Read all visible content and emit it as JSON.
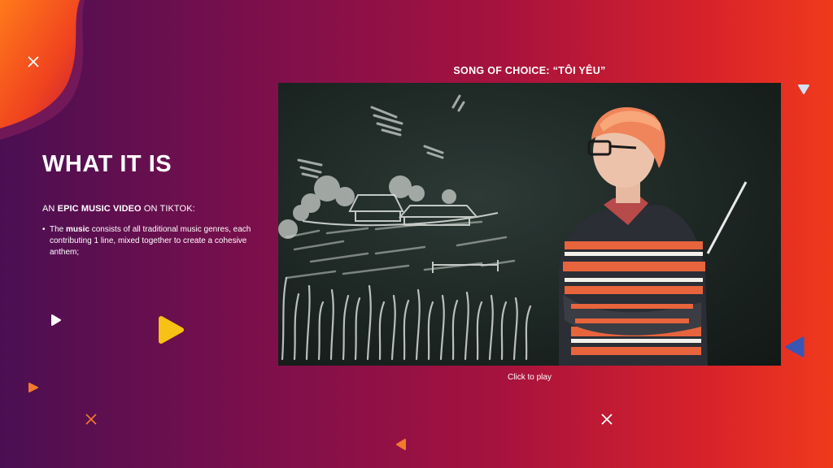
{
  "heading": "WHAT IT IS",
  "intro": {
    "prefix": "AN ",
    "bold": "EPIC MUSIC VIDEO",
    "suffix": " ON TIKTOK:"
  },
  "bullets": [
    {
      "prefix": "The ",
      "bold": "music",
      "rest": " consists of all traditional music genres, each contributing 1 line, mixed together to create a cohesive anthem;"
    }
  ],
  "song": {
    "title": "SONG OF CHOICE: “TÔI YÊU”"
  },
  "video": {
    "caption": "Click to play"
  },
  "colors": {
    "accent_yellow": "#f7c116",
    "accent_orange": "#f27a2c",
    "accent_blue": "#3a56b5",
    "accent_light_blue": "#cfe3f5"
  },
  "icons": [
    "close-icon",
    "play-icon",
    "triangle-icon"
  ]
}
